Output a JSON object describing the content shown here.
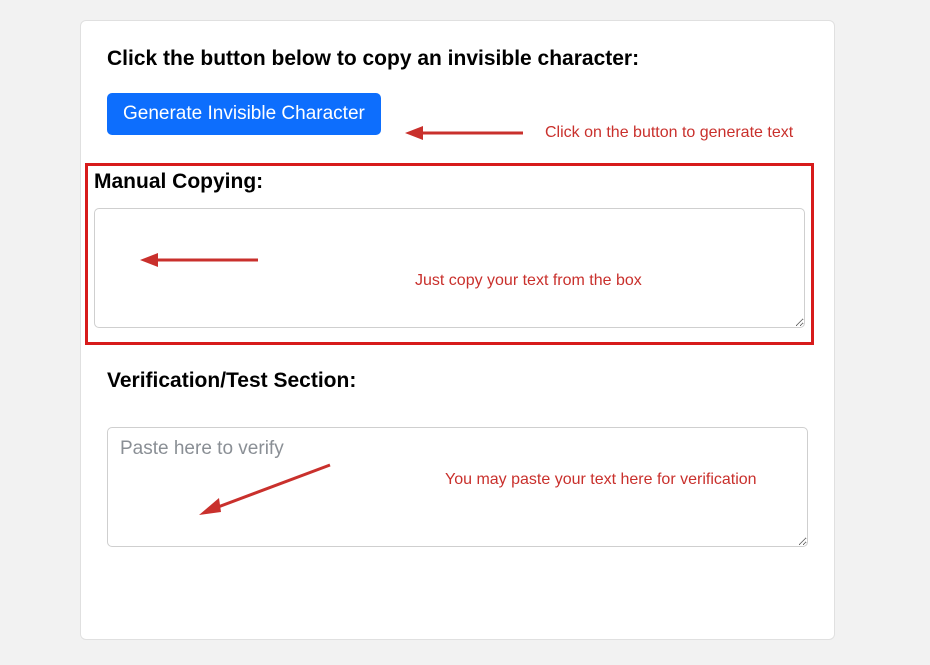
{
  "instruction_text": "Click the button below to copy an invisible character:",
  "generate_button_label": "Generate Invisible Character",
  "manual_section_heading": "Manual Copying:",
  "manual_textarea_value": "",
  "verify_section_heading": "Verification/Test Section:",
  "verify_textarea_placeholder": "Paste here to verify",
  "verify_textarea_value": "",
  "annotations": {
    "generate_hint": "Click on the button to generate text",
    "copy_hint": "Just copy your text from the box",
    "verify_hint": "You may paste your text here for verification"
  },
  "colors": {
    "button_bg": "#0d6efd",
    "annotation_red": "#c9302c",
    "highlight_box_red": "#d71b1b"
  }
}
